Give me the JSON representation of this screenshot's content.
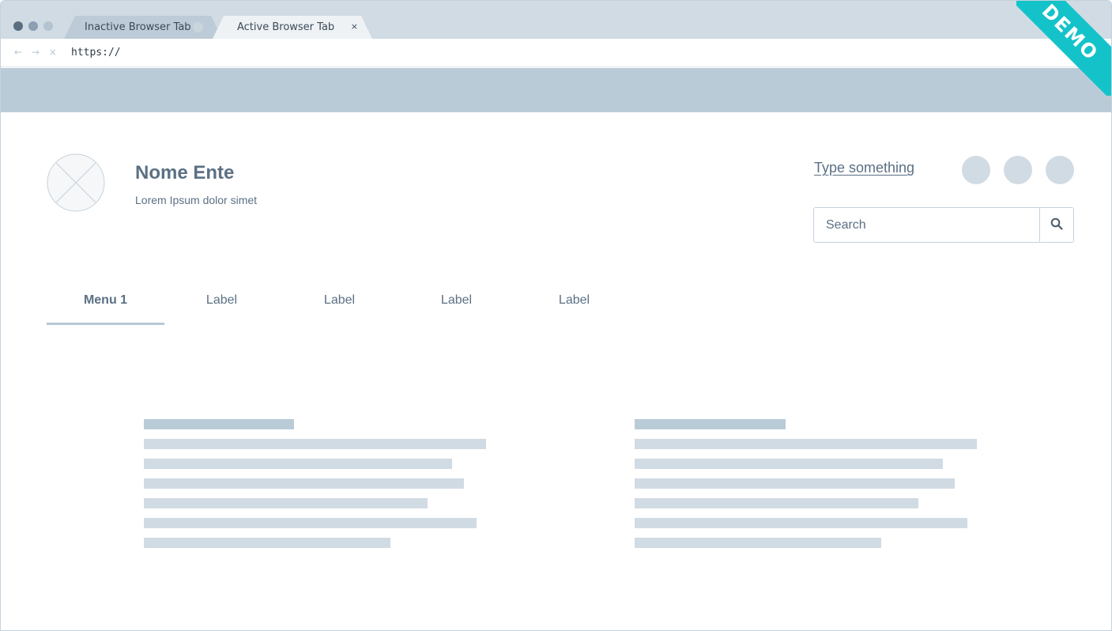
{
  "browser": {
    "tabs": [
      {
        "label": "Inactive Browser Tab",
        "active": false
      },
      {
        "label": "Active Browser Tab",
        "active": true,
        "close_glyph": "×"
      }
    ],
    "nav_icons": "← → ×",
    "url": "https://",
    "ribbon_text": "DEMO"
  },
  "header": {
    "logo_icon": "image-placeholder-icon",
    "title": "Nome Ente",
    "subtitle": "Lorem Ipsum dolor simet",
    "link_text": "Type something",
    "social_icons": [
      "social-icon",
      "social-icon",
      "social-icon"
    ],
    "search": {
      "placeholder": "Search",
      "icon": "search-icon"
    }
  },
  "menu": {
    "items": [
      {
        "label": "Menu 1",
        "active": true
      },
      {
        "label": "Label",
        "active": false
      },
      {
        "label": "Label",
        "active": false
      },
      {
        "label": "Label",
        "active": false
      },
      {
        "label": "Label",
        "active": false
      }
    ]
  },
  "colors": {
    "accent": "#5b7084",
    "chrome": "#d0dbe4",
    "banner": "#bacbd8",
    "ribbon": "#14c3c9"
  }
}
